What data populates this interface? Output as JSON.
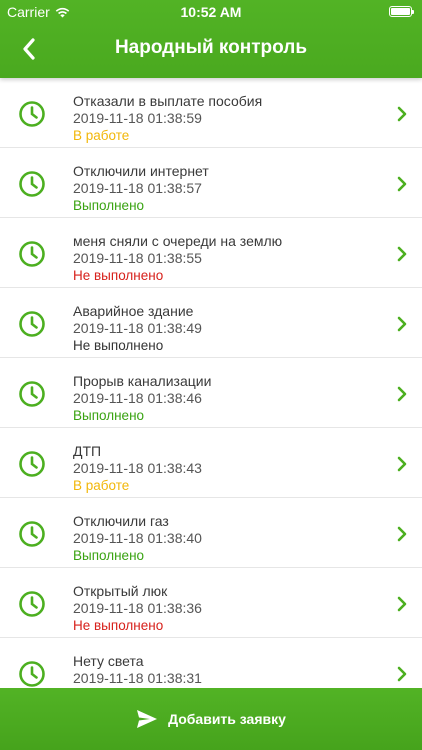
{
  "status_bar": {
    "carrier": "Carrier",
    "time": "10:52 AM"
  },
  "header": {
    "title": "Народный контроль"
  },
  "colors": {
    "accent": "#4caf20",
    "in_progress": "#f2b70a",
    "done": "#3aa312",
    "not_done": "#d7201b",
    "neutral": "#333333"
  },
  "items": [
    {
      "title": "Отказали в выплате пособия",
      "date": "2019-11-18 01:38:59",
      "status": "В работе",
      "status_type": "in_progress"
    },
    {
      "title": "Отключили интернет",
      "date": "2019-11-18 01:38:57",
      "status": "Выполнено",
      "status_type": "done"
    },
    {
      "title": "меня сняли с очереди на землю",
      "date": "2019-11-18 01:38:55",
      "status": "Не выполнено",
      "status_type": "not_done"
    },
    {
      "title": "Аварийное здание",
      "date": "2019-11-18 01:38:49",
      "status": "Не выполнено",
      "status_type": "neutral"
    },
    {
      "title": "Прорыв канализации",
      "date": "2019-11-18 01:38:46",
      "status": "Выполнено",
      "status_type": "done"
    },
    {
      "title": "ДТП",
      "date": "2019-11-18 01:38:43",
      "status": "В работе",
      "status_type": "in_progress"
    },
    {
      "title": "Отключили газ",
      "date": "2019-11-18 01:38:40",
      "status": "Выполнено",
      "status_type": "done"
    },
    {
      "title": "Открытый люк",
      "date": "2019-11-18 01:38:36",
      "status": "Не выполнено",
      "status_type": "not_done"
    },
    {
      "title": "Нету света",
      "date": "2019-11-18 01:38:31",
      "status": "",
      "status_type": "neutral"
    }
  ],
  "footer": {
    "add_label": "Добавить заявку"
  }
}
